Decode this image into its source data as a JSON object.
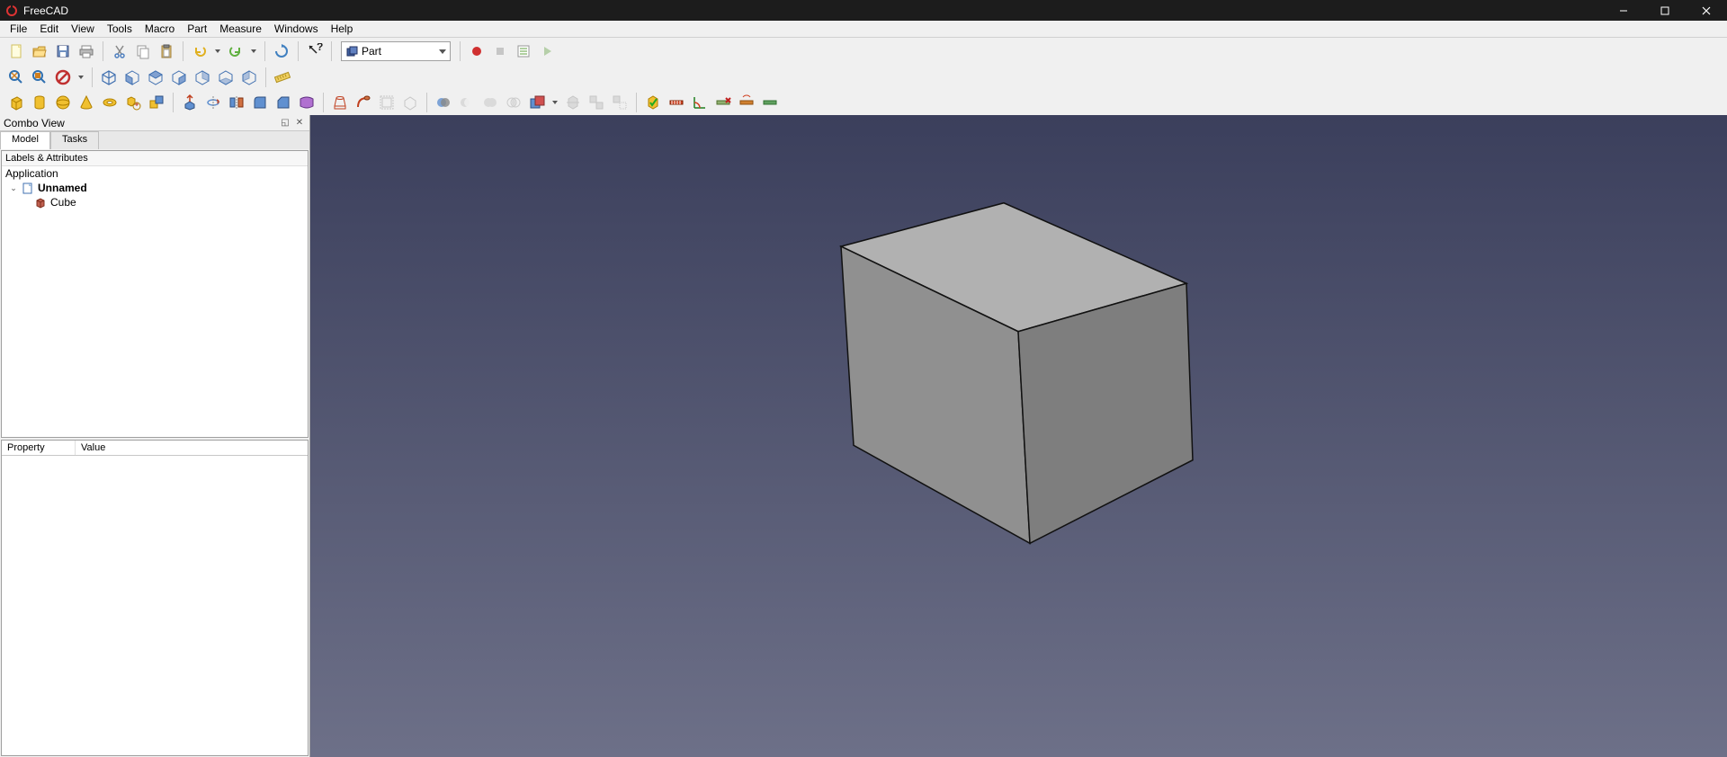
{
  "titlebar": {
    "title": "FreeCAD"
  },
  "menu": {
    "file": "File",
    "edit": "Edit",
    "view": "View",
    "tools": "Tools",
    "macro": "Macro",
    "part": "Part",
    "measure": "Measure",
    "windows": "Windows",
    "help": "Help"
  },
  "workbench": {
    "label": "Part"
  },
  "combo": {
    "title": "Combo View",
    "tab_model": "Model",
    "tab_tasks": "Tasks",
    "tree_header": "Labels & Attributes",
    "application": "Application",
    "doc": "Unnamed",
    "obj": "Cube",
    "prop_col1": "Property",
    "prop_col2": "Value"
  }
}
